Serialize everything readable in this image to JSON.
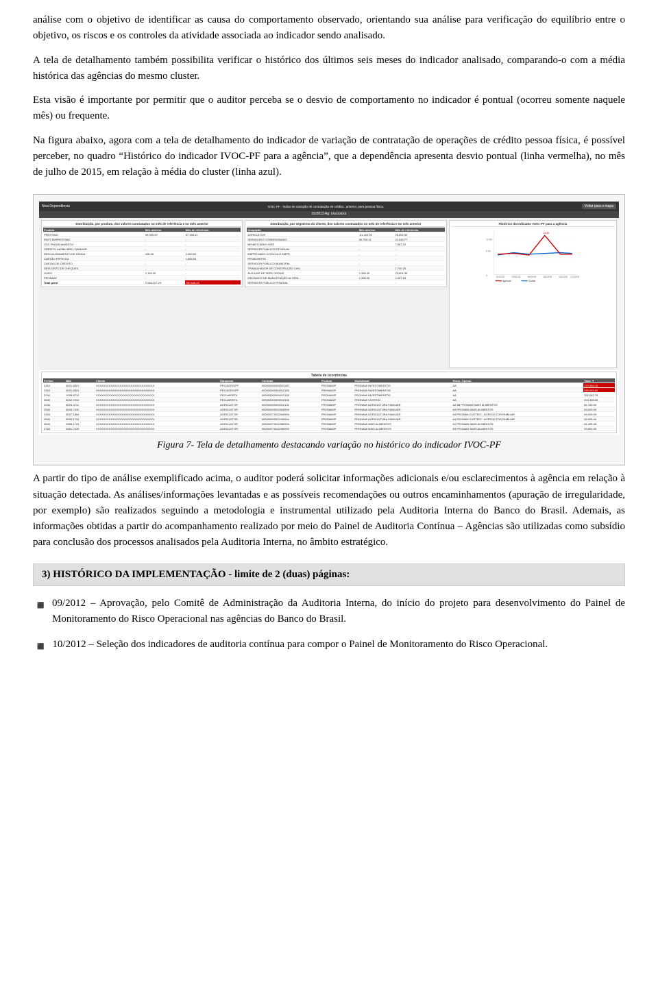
{
  "paragraphs": {
    "p1": "análise com o objetivo de identificar as causa do comportamento observado, orientando sua análise para verificação do equilíbrio entre o objetivo, os riscos e os controles da atividade associada ao indicador sendo analisado.",
    "p2": "A tela de detalhamento também possibilita verificar o histórico dos últimos seis meses do indicador analisado, comparando-o com a média histórica das agências do mesmo cluster.",
    "p3": "Esta visão é importante por permitir que o auditor perceba se o desvio de comportamento no indicador é pontual (ocorreu somente naquele mês) ou frequente.",
    "p4": "Na figura abaixo, agora com a tela de detalhamento do indicador de variação de contratação de operações de crédito pessoa física, é possível perceber, no quadro “Histórico do indicador IVOC-PF para a agência”, que a dependência apresenta desvio pontual (linha vermelha), no mês de julho de 2015, em relação à média do cluster (linha azul).",
    "p5": "A partir do tipo de análise exemplificado acima, o auditor poderá solicitar informações adicionais e/ou esclarecimentos à agência em relação à situação detectada. As análises/informações levantadas e as possíveis recomendações ou outros encaminhamentos (apuração de irregularidade, por exemplo) são realizados seguindo a metodologia e instrumental utilizado pela Auditoria Interna do Banco do Brasil. Ademais, as informações obtidas a partir do acompanhamento realizado por meio do Painel de Auditoria Contínua – Agências são utilizadas como subsídio para conclusão dos processos analisados pela Auditoria Interna, no âmbito estratégico."
  },
  "figure": {
    "caption": "Figura 7- Tela de detalhamento destacando variação no histórico do indicador IVOC-PF"
  },
  "section": {
    "header": "3) HISTÓRICO DA IMPLEMENTAÇÃO - limite de 2 (duas) páginas:"
  },
  "bullets": [
    {
      "id": "b1",
      "marker": "◾",
      "text": "09/2012 – Aprovação, pelo Comitê de Administração da Auditoria Interna, do início do projeto para desenvolvimento do Painel de Monitoramento do Risco Operacional nas agências do Banco do Brasil."
    },
    {
      "id": "b2",
      "marker": "◾",
      "text": "10/2012 – Seleção dos indicadores de auditoria contínua para compor o Painel de Monitoramento do Risco Operacional."
    }
  ],
  "dashboard": {
    "header_left": "Niva     Dependência",
    "header_id": "01/2013   Ag: xxxxxxxxx",
    "title": "IVOC PF - Índice de variação de contratação de crédito...anterior, para pessoa física.",
    "back_btn": "Voltar para o mapa",
    "left_panel_title": "Distribuição, por produto, dos valores contratados no mês de referência e no mês anterior",
    "mid_panel_title": "Distribuição, por segmento do cliente, dos valores contratados no mês de referência e no mês anterior",
    "right_panel_title": "Histórico do Indicador IVOC-PF para a agência",
    "ocorr_title": "Tabela de ocorrências"
  }
}
